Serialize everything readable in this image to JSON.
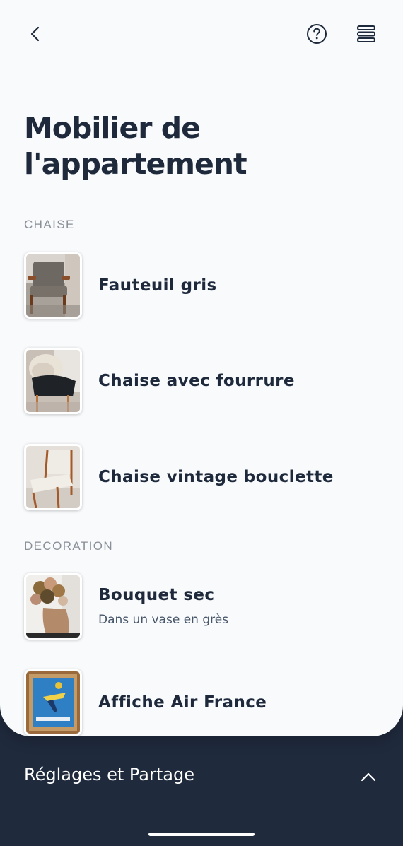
{
  "header": {
    "title": "Mobilier de l'appartement",
    "back_icon": "chevron-left-icon",
    "help_icon": "help-circle-icon",
    "menu_icon": "menu-lines-icon"
  },
  "sections": [
    {
      "title": "CHAISE",
      "items": [
        {
          "title": "Fauteuil gris",
          "subtitle": "",
          "thumbnail": "armchair-gray-photo"
        },
        {
          "title": "Chaise avec fourrure",
          "subtitle": "",
          "thumbnail": "chair-fur-photo"
        },
        {
          "title": "Chaise vintage bouclette",
          "subtitle": "",
          "thumbnail": "chair-boucle-photo"
        }
      ]
    },
    {
      "title": "DECORATION",
      "items": [
        {
          "title": "Bouquet sec",
          "subtitle": "Dans un vase en grès",
          "thumbnail": "dried-bouquet-photo"
        },
        {
          "title": "Affiche Air France",
          "subtitle": "",
          "thumbnail": "air-france-poster-photo"
        }
      ]
    }
  ],
  "bottom_sheet": {
    "label": "Réglages et Partage",
    "toggle_icon": "chevron-up-icon"
  },
  "colors": {
    "background": "#f8fafc",
    "text_primary": "#1e293b",
    "section_label": "#8a8f98",
    "bottom_bar": "#1f2a3d"
  }
}
